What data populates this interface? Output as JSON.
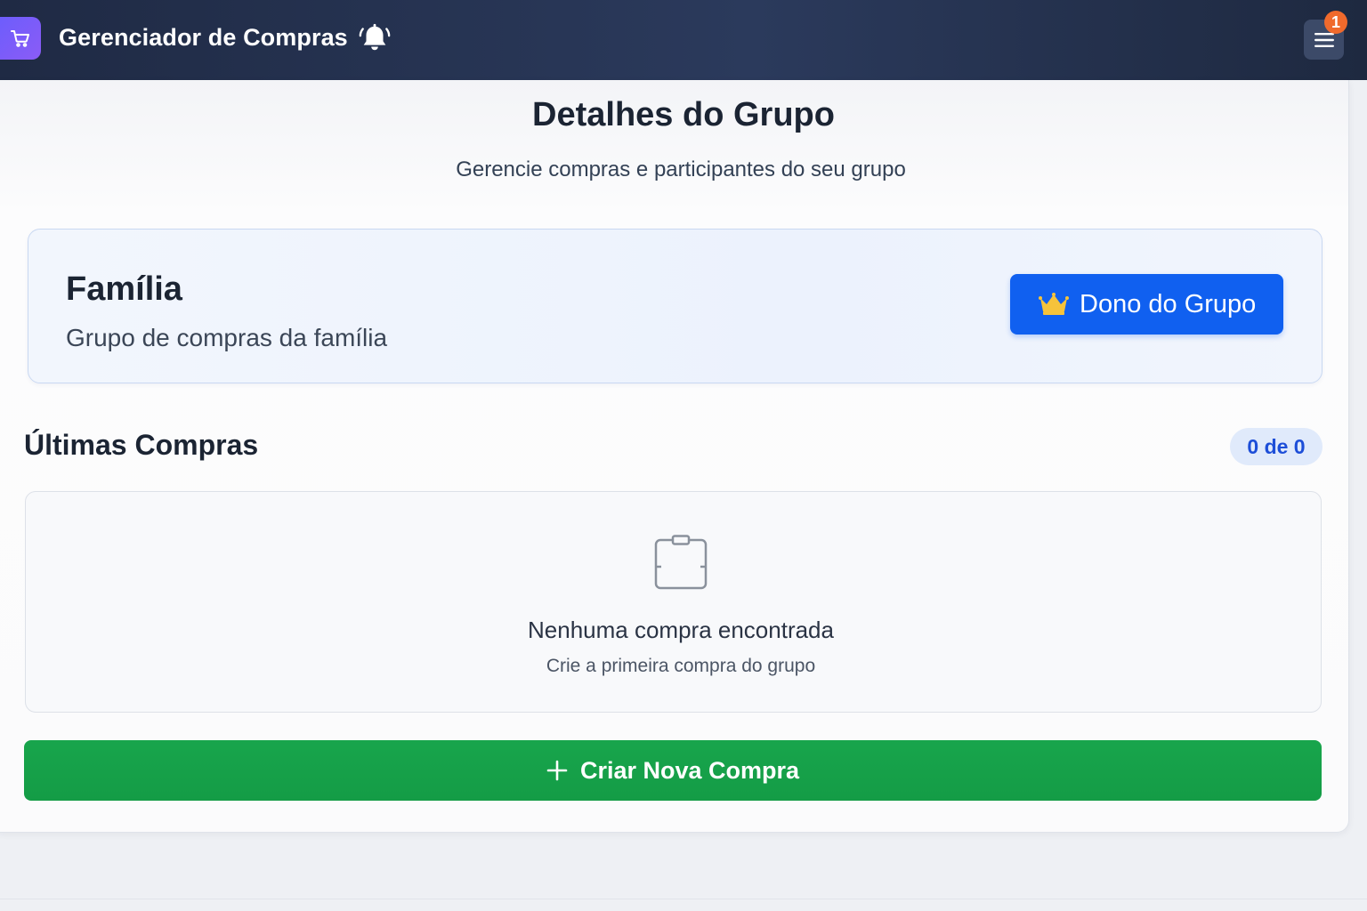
{
  "header": {
    "app_title": "Gerenciador de Compras",
    "notification_count": "1",
    "icons": {
      "logo": "shopping-cart-icon",
      "bell": "bell-icon",
      "menu": "hamburger-menu-icon"
    }
  },
  "page": {
    "title": "Detalhes do Grupo",
    "subtitle": "Gerencie compras e participantes do seu grupo"
  },
  "group": {
    "name": "Família",
    "description": "Grupo de compras da família",
    "role_button": "Dono do Grupo",
    "role_icon": "crown-icon"
  },
  "purchases": {
    "section_title": "Últimas Compras",
    "count_label": "0 de 0",
    "empty_title": "Nenhuma compra encontrada",
    "empty_subtitle": "Crie a primeira compra do grupo",
    "empty_icon": "clipboard-icon",
    "create_button": "Criar Nova Compra",
    "create_icon": "plus-icon"
  },
  "colors": {
    "header_bg": "#1f2a44",
    "logo_accent": "#7c5cf6",
    "primary_blue": "#1060f0",
    "success_green": "#16a34a",
    "badge_orange": "#f06a2c"
  }
}
